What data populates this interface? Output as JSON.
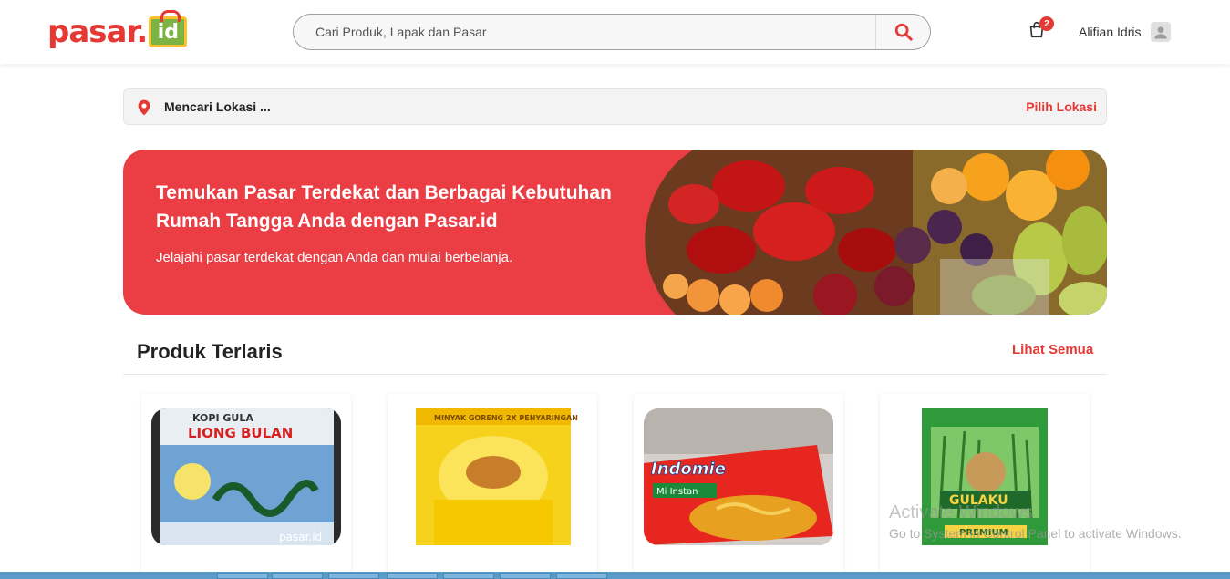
{
  "header": {
    "logo_text": "pasar.",
    "logo_badge": "id",
    "search_placeholder": "Cari Produk, Lapak dan Pasar",
    "cart_count": "2",
    "user_name": "Alifian Idris",
    "brand_color": "#e53935"
  },
  "location": {
    "status": "Mencari Lokasi ...",
    "action": "Pilih Lokasi"
  },
  "banner": {
    "title": "Temukan Pasar Terdekat dan Berbagai Kebutuhan Rumah Tangga Anda dengan Pasar.id",
    "subtitle": "Jelajahi pasar terdekat dengan Anda dan mulai berbelanja.",
    "background": "#ea3d44"
  },
  "section": {
    "title": "Produk Terlaris",
    "see_all": "Lihat Semua"
  },
  "products": [
    {
      "image": "coffee-bag-image"
    },
    {
      "image": "cooking-oil-pouch-image"
    },
    {
      "image": "instant-noodle-image"
    },
    {
      "image": "sugar-pack-image"
    }
  ],
  "watermark": {
    "line1": "Activate Windows",
    "line2": "Go to System in Control Panel to activate Windows."
  }
}
